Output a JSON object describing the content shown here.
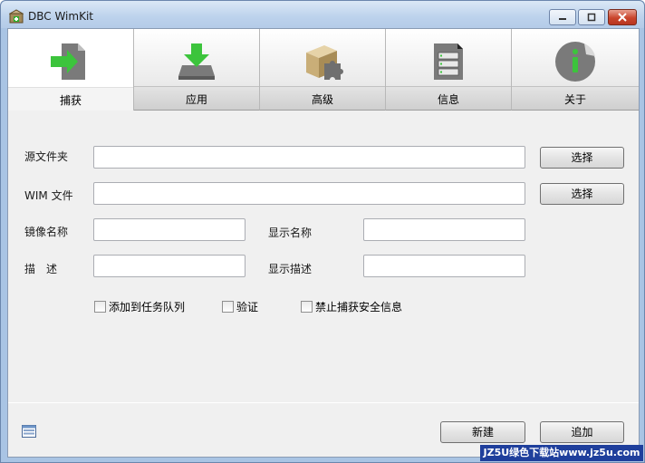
{
  "window": {
    "title": "DBC WimKit",
    "icons": {
      "app": "app-box-icon",
      "minimize": "minimize-icon",
      "maximize": "maximize-icon",
      "close": "close-icon"
    }
  },
  "tabs": [
    {
      "label": "捕获",
      "icon": "capture-arrow-icon",
      "active": true
    },
    {
      "label": "应用",
      "icon": "apply-download-icon",
      "active": false
    },
    {
      "label": "高级",
      "icon": "puzzle-box-icon",
      "active": false
    },
    {
      "label": "信息",
      "icon": "info-list-icon",
      "active": false
    },
    {
      "label": "关于",
      "icon": "about-info-icon",
      "active": false
    }
  ],
  "form": {
    "source_folder_label": "源文件夹",
    "source_folder_value": "",
    "wim_file_label": "WIM 文件",
    "wim_file_value": "",
    "browse_label": "选择",
    "image_name_label": "镜像名称",
    "image_name_value": "",
    "display_name_label": "显示名称",
    "display_name_value": "",
    "description_label": "描　述",
    "description_value": "",
    "display_desc_label": "显示描述",
    "display_desc_value": ""
  },
  "options": [
    {
      "label": "添加到任务队列",
      "checked": false
    },
    {
      "label": "验证",
      "checked": false
    },
    {
      "label": "禁止捕获安全信息",
      "checked": false
    }
  ],
  "footer": {
    "new_label": "新建",
    "append_label": "追加",
    "status_icon": "task-list-icon"
  },
  "watermark": "JZ5U绿色下载站www.jz5u.com",
  "colors": {
    "accent_green": "#3cc43c",
    "close_red": "#c9452c",
    "titlebar": "#bcd2ec"
  }
}
